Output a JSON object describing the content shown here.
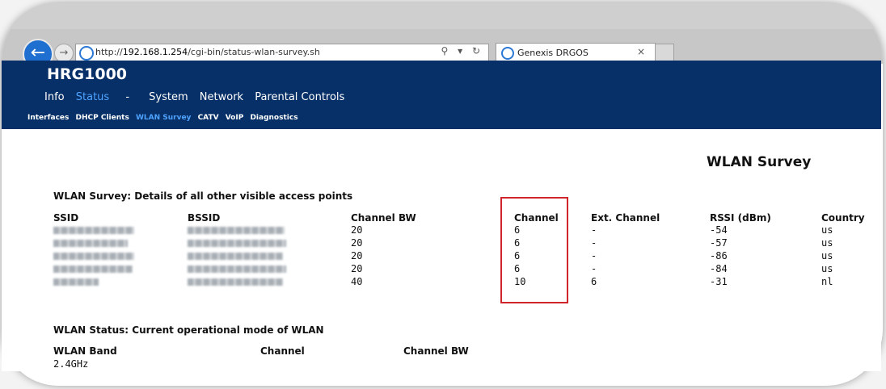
{
  "browser": {
    "url_prefix": "http://",
    "url_host": "192.168.1.254",
    "url_path": "/cgi-bin/status-wlan-survey.sh",
    "tab_title": "Genexis DRGOS",
    "address_controls": "⚲ ▾ ↻",
    "back_glyph": "←",
    "forward_glyph": "→",
    "close_glyph": "×"
  },
  "header": {
    "logo": "HRG1000",
    "nav": [
      {
        "label": "Info"
      },
      {
        "label": "Status",
        "active": true
      },
      {
        "label": "-"
      },
      {
        "label": "System"
      },
      {
        "label": "Network"
      },
      {
        "label": "Parental Controls"
      }
    ],
    "subnav": [
      {
        "label": "Interfaces"
      },
      {
        "label": "DHCP Clients"
      },
      {
        "label": "WLAN Survey",
        "active": true
      },
      {
        "label": "CATV"
      },
      {
        "label": "VoIP"
      },
      {
        "label": "Diagnostics"
      }
    ]
  },
  "page": {
    "title": "WLAN Survey",
    "survey_heading": "WLAN Survey: Details of all other visible access points",
    "survey_columns": [
      "SSID",
      "BSSID",
      "Channel BW",
      "Channel",
      "Ext. Channel",
      "RSSI (dBm)",
      "Country"
    ],
    "survey_rows": [
      {
        "channel_bw": "20",
        "channel": "6",
        "ext_channel": "-",
        "rssi": "-54",
        "country": "us"
      },
      {
        "channel_bw": "20",
        "channel": "6",
        "ext_channel": "-",
        "rssi": "-57",
        "country": "us"
      },
      {
        "channel_bw": "20",
        "channel": "6",
        "ext_channel": "-",
        "rssi": "-86",
        "country": "us"
      },
      {
        "channel_bw": "20",
        "channel": "6",
        "ext_channel": "-",
        "rssi": "-84",
        "country": "us"
      },
      {
        "channel_bw": "40",
        "channel": "10",
        "ext_channel": "6",
        "rssi": "-31",
        "country": "nl"
      }
    ],
    "status_heading": "WLAN Status: Current operational mode of WLAN",
    "status_columns": [
      "WLAN Band",
      "Channel",
      "Channel BW"
    ],
    "status_values": {
      "band": "2.4GHz"
    }
  },
  "colors": {
    "header_bg": "#063067",
    "active_link": "#4fa3ff",
    "highlight_box": "#d0252a"
  }
}
